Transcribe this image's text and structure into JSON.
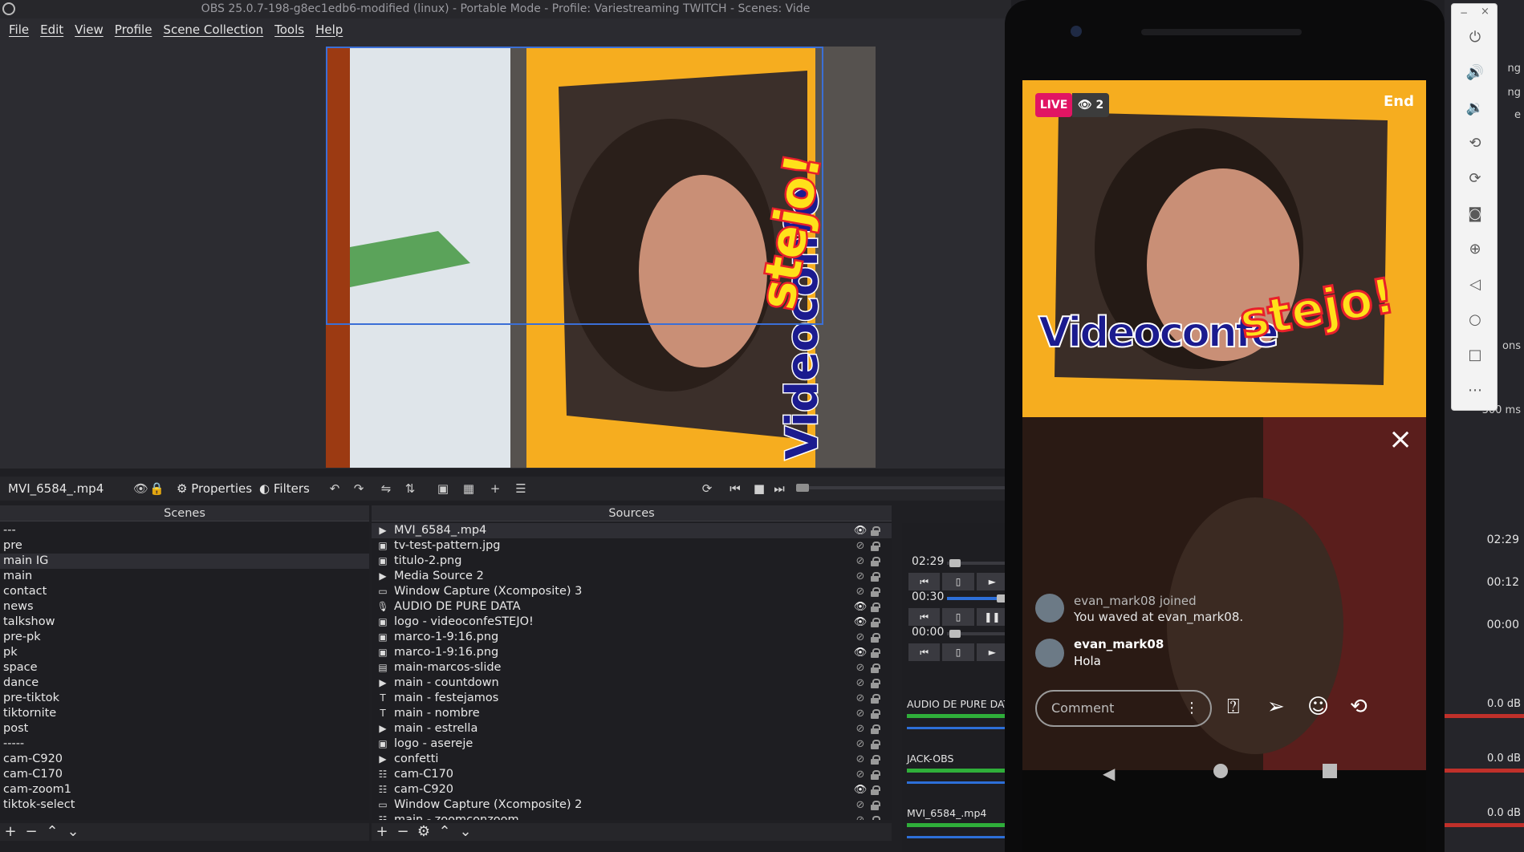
{
  "window": {
    "title": "OBS 25.0.7-198-g8ec1edb6-modified (linux) - Portable Mode - Profile: Variestreaming TWITCH - Scenes: Vide"
  },
  "menu": [
    "File",
    "Edit",
    "View",
    "Profile",
    "Scene Collection",
    "Tools",
    "Help"
  ],
  "preview": {
    "graphic_text_white": "Videoconfe",
    "graphic_text_yellow": "stejo!"
  },
  "propbar": {
    "source_name": "MVI_6584_.mp4",
    "properties": "Properties",
    "filters": "Filters"
  },
  "scenes": {
    "title": "Scenes",
    "items": [
      "---",
      "pre",
      "main IG",
      "main",
      "contact",
      "news",
      "talkshow",
      "pre-pk",
      "pk",
      "space",
      "dance",
      "pre-tiktok",
      "tiktornite",
      "post",
      "-----",
      "cam-C920",
      "cam-C170",
      "cam-zoom1",
      "tiktok-select"
    ],
    "selected": "main IG"
  },
  "sources": {
    "title": "Sources",
    "items": [
      {
        "type": "media",
        "name": "MVI_6584_.mp4",
        "visible": true
      },
      {
        "type": "image",
        "name": "tv-test-pattern.jpg",
        "visible": false
      },
      {
        "type": "image",
        "name": "titulo-2.png",
        "visible": false
      },
      {
        "type": "media",
        "name": "Media Source 2",
        "visible": false
      },
      {
        "type": "window",
        "name": "Window Capture (Xcomposite) 3",
        "visible": false
      },
      {
        "type": "audio",
        "name": "AUDIO DE PURE DATA",
        "visible": true
      },
      {
        "type": "image",
        "name": "logo - videoconfeSTEJO!",
        "visible": true
      },
      {
        "type": "image",
        "name": "marco-1-9:16.png",
        "visible": false
      },
      {
        "type": "image",
        "name": "marco-1-9:16.png",
        "visible": true
      },
      {
        "type": "slideshow",
        "name": "main-marcos-slide",
        "visible": false
      },
      {
        "type": "media",
        "name": "main - countdown",
        "visible": false
      },
      {
        "type": "text",
        "name": "main - festejamos",
        "visible": false
      },
      {
        "type": "text",
        "name": "main - nombre",
        "visible": false
      },
      {
        "type": "media",
        "name": "main - estrella",
        "visible": false
      },
      {
        "type": "image",
        "name": "logo - asereje",
        "visible": false
      },
      {
        "type": "media",
        "name": "confetti",
        "visible": false
      },
      {
        "type": "camera",
        "name": "cam-C170",
        "visible": false
      },
      {
        "type": "camera",
        "name": "cam-C920",
        "visible": true
      },
      {
        "type": "window",
        "name": "Window Capture (Xcomposite) 2",
        "visible": false
      },
      {
        "type": "camera",
        "name": "main - zoomconzoom",
        "visible": false
      }
    ]
  },
  "media": [
    {
      "time": "02:29",
      "progress": 0.05
    },
    {
      "time": "00:30",
      "progress": 1.0
    },
    {
      "time": "00:00",
      "progress": 0.05
    }
  ],
  "mixer": [
    {
      "name": "AUDIO DE PURE DAT"
    },
    {
      "name": "JACK-OBS"
    },
    {
      "name": "MVI_6584_.mp4"
    }
  ],
  "right_strip": {
    "times": [
      "02:29",
      "00:12",
      "00:00"
    ],
    "db": [
      "0.0 dB",
      "0.0 dB",
      "0.0 dB"
    ],
    "misc": [
      "ng",
      "ng",
      "e",
      "ons",
      "300 ms"
    ]
  },
  "phone": {
    "live_badge": "LIVE",
    "viewers": "2",
    "end": "End",
    "graphic_text_white": "Videoconfe",
    "graphic_text_yellow": "stejo!",
    "comments": [
      {
        "user": "evan_mark08 joined",
        "text": "You waved at evan_mark08."
      },
      {
        "user": "evan_mark08",
        "text": "Hola"
      }
    ],
    "comment_placeholder": "Comment"
  }
}
